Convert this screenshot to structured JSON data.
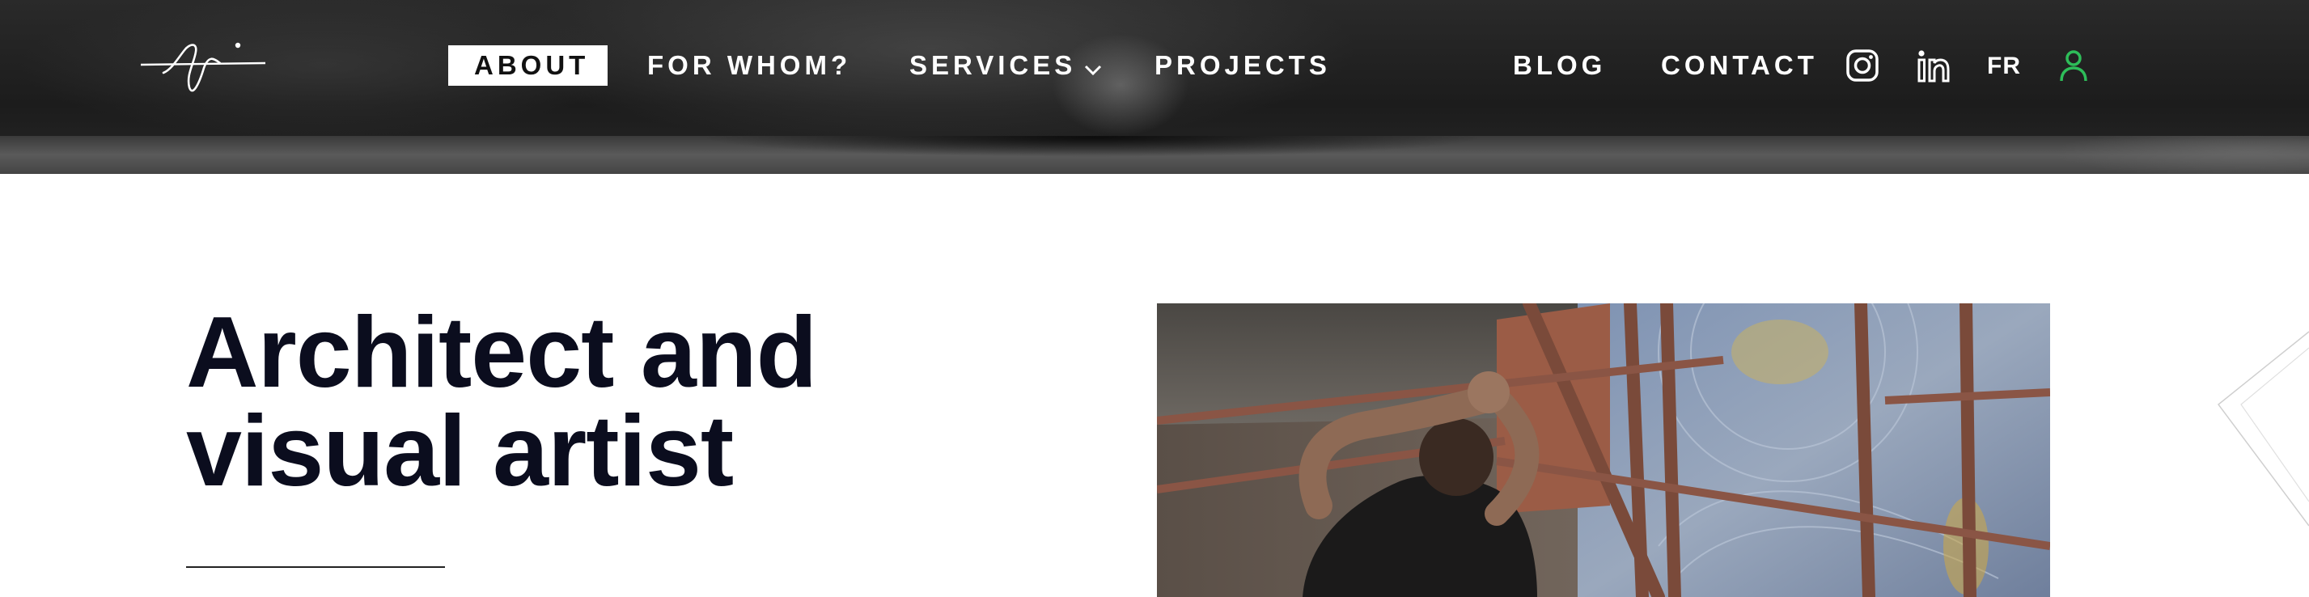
{
  "header": {
    "logo_icon": "signature-logo",
    "nav": [
      {
        "label": "ABOUT",
        "active": true
      },
      {
        "label": "FOR WHOM?"
      },
      {
        "label": "SERVICES",
        "icon": "chevron-down-icon"
      },
      {
        "label": "PROJECTS"
      },
      {
        "label": "BLOG"
      },
      {
        "label": "CONTACT"
      }
    ],
    "social": [
      "instagram-icon",
      "linkedin-icon"
    ],
    "lang": "FR",
    "account_icon": "user-icon",
    "colors": {
      "accent_green": "#2ebd59",
      "title_navy": "#0b0d1e"
    }
  },
  "hero": {
    "title_line1": "Architect and",
    "title_line2": "visual artist"
  }
}
